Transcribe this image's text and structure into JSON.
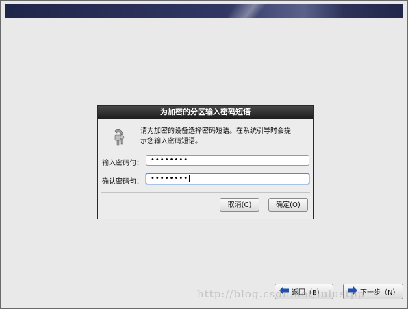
{
  "dialog": {
    "title": "为加密的分区输入密码短语",
    "prompt_line1": "请为加密的设备选择密码短语。在系统引导时会提",
    "prompt_line2": "示您输入密码短语。",
    "passphrase_label": "输入密码句：",
    "passphrase_value": "••••••••",
    "confirm_label": "确认密码句：",
    "confirm_value": "••••••••",
    "cancel_label": "取消(C)",
    "ok_label": "确定(O)"
  },
  "nav": {
    "back_label": "返回（B）",
    "next_label": "下一步（N）"
  },
  "watermark": "http://blog.csdn.net/lulustpp",
  "colors": {
    "banner": "#2a3058",
    "background": "#e9e9e9",
    "arrow": "#1f4fb0"
  },
  "icons": {
    "dialog_icon": "lock-keys-icon",
    "back_icon": "arrow-left-icon",
    "next_icon": "arrow-right-icon"
  }
}
